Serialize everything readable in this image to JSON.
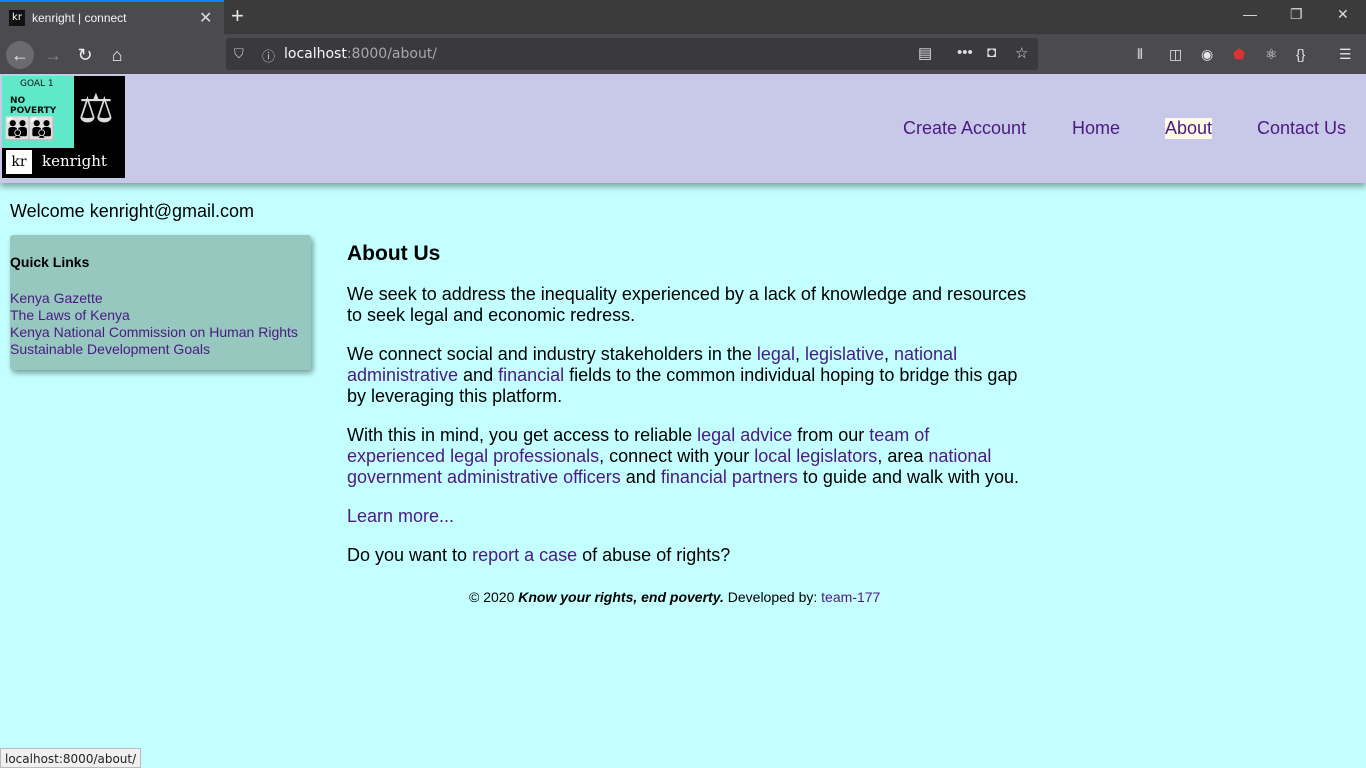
{
  "browser": {
    "tab_title": "kenright | connect",
    "tab_favicon": "kr",
    "url_host": "localhost",
    "url_path": ":8000/about/",
    "status_url": "localhost:8000/about/"
  },
  "logo": {
    "goal_text": "GOAL 1",
    "poverty_text": "NO POVERTY",
    "kr_text": "kr",
    "name_text": "kenright"
  },
  "nav": {
    "create_account": "Create Account",
    "home": "Home",
    "about": "About",
    "contact": "Contact Us"
  },
  "welcome": "Welcome kenright@gmail.com",
  "quick_links": {
    "title": "Quick Links",
    "items": [
      "Kenya Gazette",
      "The Laws of Kenya",
      "Kenya National Commission on Human Rights",
      "Sustainable Development Goals"
    ]
  },
  "about": {
    "title": "About Us",
    "p1": "We seek to address the inequality experienced by a lack of knowledge and resources to seek legal and economic redress.",
    "p2_a": "We connect social and industry stakeholders in the ",
    "link_legal": "legal",
    "comma1": ", ",
    "link_legislative": "legislative",
    "comma2": ", ",
    "link_national_admin": "national administrative",
    "and1": " and ",
    "link_financial": "financial",
    "p2_b": " fields to the common individual hoping to bridge this gap by leveraging this platform.",
    "p3_a": "With this in mind, you get access to reliable ",
    "link_legal_advice": "legal advice",
    "p3_b": " from our ",
    "link_team": "team of experienced legal professionals",
    "p3_c": ", connect with your ",
    "link_legislators": "local legislators",
    "p3_d": ", area ",
    "link_officers": "national government administrative officers",
    "p3_e": " and ",
    "link_partners": "financial partners",
    "p3_f": " to guide and walk with you.",
    "learn_more": "Learn more...",
    "p4_a": "Do you want to ",
    "link_report": "report a case",
    "p4_b": " of abuse of rights?"
  },
  "footer": {
    "copyright": "© 2020 ",
    "tagline": "Know your rights, end poverty.",
    "developed_by": " Developed by: ",
    "team": "team-177"
  }
}
